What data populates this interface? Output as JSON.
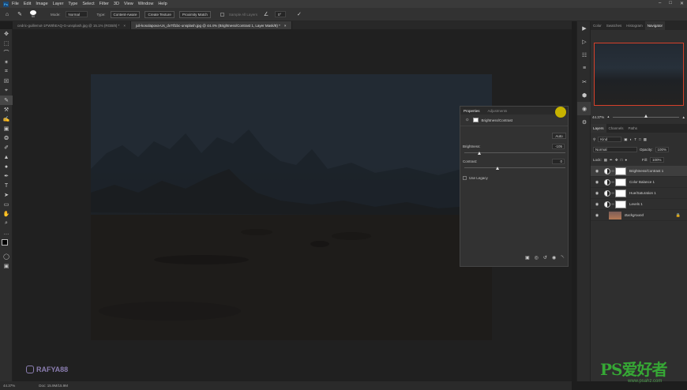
{
  "menu": {
    "logo": "Ps",
    "items": [
      "File",
      "Edit",
      "Image",
      "Layer",
      "Type",
      "Select",
      "Filter",
      "3D",
      "View",
      "Window",
      "Help"
    ]
  },
  "window_controls": [
    "–",
    "□",
    "✕"
  ],
  "options": {
    "brush_size": "50",
    "mode_label": "Mode:",
    "mode_value": "Normal",
    "type_label": "Type:",
    "btn_content_aware": "Content-Aware",
    "btn_create_texture": "Create Texture",
    "btn_proximity": "Proximity Match",
    "sample_all_layers": "Sample All Layers",
    "angle_value": "0°"
  },
  "tabs": [
    {
      "label": "cedric-guillemot-1FW8hEAQ-G-unsplash.jpg @ 15.1% (RGB/8) *",
      "close": "×"
    },
    {
      "label": "juli-kosolapova-Us_dv7tf1bc-unsplash.jpg @ 44.4% (Brightness/Contrast 1, Layer Mask/8) *",
      "close": "×"
    }
  ],
  "tools": [
    "✥",
    "⬚",
    "⌒",
    "✶",
    "⌗",
    "☒",
    "⌖",
    "✎",
    "⚒",
    "✍",
    "▣",
    "❂",
    "✐",
    "▲",
    "●",
    "✒",
    "T",
    "➤",
    "▭",
    "✋",
    "⌕",
    "…"
  ],
  "watermark_handle": "RAFYA88",
  "status": {
    "zoom": "44.37%",
    "doc": "Doc: 15.9M/15.9M"
  },
  "properties": {
    "tab_active": "Properties",
    "tab_inactive": "Adjustments",
    "header": "Brightness/Contrast",
    "auto_label": "Auto",
    "brightness_label": "Brightness:",
    "brightness_value": "-105",
    "brightness_level": -105,
    "contrast_label": "Contrast:",
    "contrast_value": "0",
    "contrast_level": 0,
    "use_legacy_label": "Use Legacy",
    "footer_icons": [
      "▣",
      "◎",
      "↺",
      "◉",
      "␡"
    ]
  },
  "right_icons": [
    "▶",
    "▷",
    "☷",
    "≡",
    "✂",
    "⬢",
    "◉",
    "⚙"
  ],
  "nav_tabs": [
    "Color",
    "Swatches",
    "Histogram",
    "Navigator"
  ],
  "navigator_zoom": "44.37%",
  "layers_tabs": [
    "Layers",
    "Channels",
    "Paths"
  ],
  "layers_controls": {
    "kind_label": "Kind",
    "blend_mode": "Normal",
    "opacity_label": "Opacity:",
    "opacity_value": "100%",
    "lock_label": "Lock:",
    "fill_label": "Fill:",
    "fill_value": "100%"
  },
  "layers": [
    {
      "name": "Brightness/Contrast 1",
      "type": "adjustment",
      "selected": true
    },
    {
      "name": "Color Balance 1",
      "type": "adjustment",
      "selected": false
    },
    {
      "name": "Hue/Saturation 1",
      "type": "adjustment",
      "selected": false
    },
    {
      "name": "Levels 1",
      "type": "adjustment",
      "selected": false
    },
    {
      "name": "Background",
      "type": "image",
      "selected": false
    }
  ],
  "site_watermark": "PS爱好者",
  "site_url": "www.psahz.com"
}
